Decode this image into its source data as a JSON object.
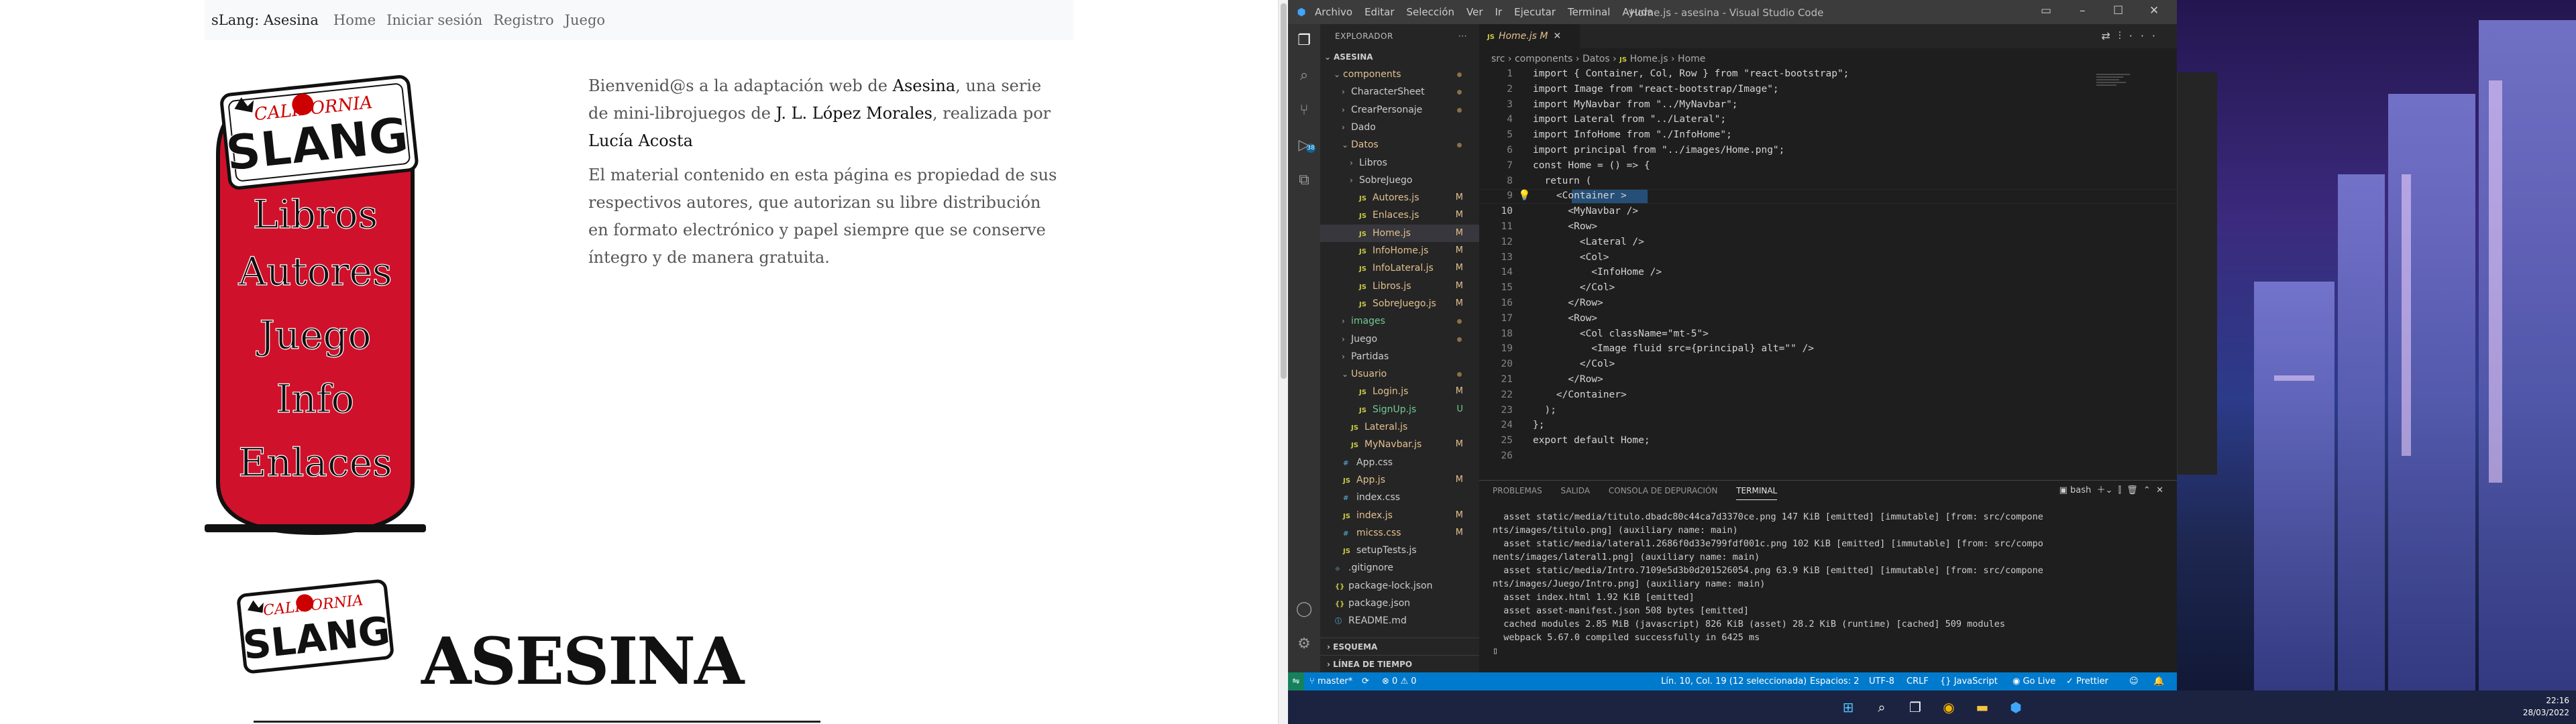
{
  "website": {
    "navbar": {
      "brand": "sLang: Asesina",
      "links": [
        "Home",
        "Iniciar sesión",
        "Registro",
        "Juego"
      ]
    },
    "banner": {
      "logo_top": "CALIFORNIA",
      "logo_main": "SLANG",
      "menu": [
        "Libros",
        "Autores",
        "Juego",
        "Info",
        "Enlaces"
      ]
    },
    "intro": {
      "p1_a": "Bienvenid@s a la adaptación web de ",
      "p1_title": "Asesina",
      "p1_b": ", una serie de mini-librojuegos de ",
      "p1_author": "J. L. López Morales",
      "p1_c": ", realizada por ",
      "p1_maker": "Lucía Acosta",
      "p2": "El material contenido en esta página es propiedad de sus respectivos autores, que autorizan su libre distribución en formato electrónico y papel siempre que se conserve íntegro y de manera gratuita."
    },
    "logo2": {
      "top": "CALIFORNIA",
      "main": "SLANG"
    },
    "game_title": "ASESINA"
  },
  "vscode": {
    "menu": [
      "Archivo",
      "Editar",
      "Selección",
      "Ver",
      "Ir",
      "Ejecutar",
      "Terminal",
      "Ayuda"
    ],
    "window_title": "Home.js - asesina - Visual Studio Code",
    "explorer_title": "EXPLORADOR",
    "project": "ASESINA",
    "tree": [
      {
        "name": "components",
        "type": "folder-open",
        "indent": 1,
        "status": "dot",
        "cls": "m"
      },
      {
        "name": "CharacterSheet",
        "type": "folder",
        "indent": 2,
        "status": "dot",
        "cls": ""
      },
      {
        "name": "CrearPersonaje",
        "type": "folder",
        "indent": 2,
        "status": "dot",
        "cls": ""
      },
      {
        "name": "Dado",
        "type": "folder",
        "indent": 2,
        "status": "",
        "cls": ""
      },
      {
        "name": "Datos",
        "type": "folder-open",
        "indent": 2,
        "status": "dot",
        "cls": "m"
      },
      {
        "name": "Libros",
        "type": "folder",
        "indent": 3,
        "status": "",
        "cls": ""
      },
      {
        "name": "SobreJuego",
        "type": "folder",
        "indent": 3,
        "status": "",
        "cls": ""
      },
      {
        "name": "Autores.js",
        "type": "js",
        "indent": 3,
        "status": "M",
        "cls": "m"
      },
      {
        "name": "Enlaces.js",
        "type": "js",
        "indent": 3,
        "status": "M",
        "cls": "m"
      },
      {
        "name": "Home.js",
        "type": "js",
        "indent": 3,
        "status": "M",
        "cls": "m",
        "selected": true
      },
      {
        "name": "InfoHome.js",
        "type": "js",
        "indent": 3,
        "status": "M",
        "cls": "m"
      },
      {
        "name": "InfoLateral.js",
        "type": "js",
        "indent": 3,
        "status": "M",
        "cls": "m"
      },
      {
        "name": "Libros.js",
        "type": "js",
        "indent": 3,
        "status": "M",
        "cls": "m"
      },
      {
        "name": "SobreJuego.js",
        "type": "js",
        "indent": 3,
        "status": "M",
        "cls": "m"
      },
      {
        "name": "images",
        "type": "folder",
        "indent": 2,
        "status": "dot",
        "cls": "u"
      },
      {
        "name": "Juego",
        "type": "folder",
        "indent": 2,
        "status": "dot",
        "cls": ""
      },
      {
        "name": "Partidas",
        "type": "folder",
        "indent": 2,
        "status": "",
        "cls": ""
      },
      {
        "name": "Usuario",
        "type": "folder-open",
        "indent": 2,
        "status": "dot",
        "cls": "m"
      },
      {
        "name": "Login.js",
        "type": "js",
        "indent": 3,
        "status": "M",
        "cls": "m"
      },
      {
        "name": "SignUp.js",
        "type": "js",
        "indent": 3,
        "status": "U",
        "cls": "u"
      },
      {
        "name": "Lateral.js",
        "type": "js",
        "indent": 2,
        "status": "",
        "cls": "m"
      },
      {
        "name": "MyNavbar.js",
        "type": "js",
        "indent": 2,
        "status": "M",
        "cls": "m"
      },
      {
        "name": "App.css",
        "type": "css",
        "indent": 1,
        "status": "",
        "cls": ""
      },
      {
        "name": "App.js",
        "type": "js",
        "indent": 1,
        "status": "M",
        "cls": "m"
      },
      {
        "name": "index.css",
        "type": "css",
        "indent": 1,
        "status": "",
        "cls": ""
      },
      {
        "name": "index.js",
        "type": "js",
        "indent": 1,
        "status": "M",
        "cls": "m"
      },
      {
        "name": "micss.css",
        "type": "css",
        "indent": 1,
        "status": "M",
        "cls": "m"
      },
      {
        "name": "setupTests.js",
        "type": "js",
        "indent": 1,
        "status": "",
        "cls": ""
      },
      {
        "name": ".gitignore",
        "type": "git",
        "indent": 0,
        "status": "",
        "cls": ""
      },
      {
        "name": "package-lock.json",
        "type": "json",
        "indent": 0,
        "status": "",
        "cls": ""
      },
      {
        "name": "package.json",
        "type": "json",
        "indent": 0,
        "status": "",
        "cls": ""
      },
      {
        "name": "README.md",
        "type": "md",
        "indent": 0,
        "status": "",
        "cls": ""
      }
    ],
    "panels": [
      "ESQUEMA",
      "LÍNEA DE TIEMPO"
    ],
    "tab": {
      "name": "Home.js",
      "flag": "M"
    },
    "breadcrumb": [
      "src",
      "components",
      "Datos",
      "Home.js",
      "Home"
    ],
    "code": [
      [
        "import { Container, Col, Row } from \"react-bootstrap\";"
      ],
      [
        "import Image from \"react-bootstrap/Image\";"
      ],
      [
        "import MyNavbar from \"../MyNavbar\";"
      ],
      [
        "import Lateral from \"../Lateral\";"
      ],
      [
        "import InfoHome from \"./InfoHome\";"
      ],
      [
        "import principal from \"../images/Home.png\";"
      ],
      [
        "const Home = () => {"
      ],
      [
        "  return ("
      ],
      [
        "    <Container >"
      ],
      [
        "      <MyNavbar />"
      ],
      [
        "      <Row>"
      ],
      [
        "        <Lateral />"
      ],
      [
        "        <Col>"
      ],
      [
        "          <InfoHome />"
      ],
      [
        "        </Col>"
      ],
      [
        "      </Row>"
      ],
      [
        "      <Row>"
      ],
      [
        "        <Col className=\"mt-5\">"
      ],
      [
        "          <Image fluid src={principal} alt=\"\" />"
      ],
      [
        "        </Col>"
      ],
      [
        "      </Row>"
      ],
      [
        "    </Container>"
      ],
      [
        "  );"
      ],
      [
        "};"
      ],
      [
        "export default Home;"
      ],
      [
        ""
      ]
    ],
    "panel_tabs": [
      "PROBLEMAS",
      "SALIDA",
      "CONSOLA DE DEPURACIÓN",
      "TERMINAL"
    ],
    "shell": "bash",
    "terminal": [
      "  asset static/media/titulo.dbadc80c44ca7d3370ce.png 147 KiB [emitted] [immutable] [from: src/compone",
      "nts/images/titulo.png] (auxiliary name: main)",
      "  asset static/media/lateral1.2686f0d33e799fdf001c.png 102 KiB [emitted] [immutable] [from: src/compo",
      "nents/images/lateral1.png] (auxiliary name: main)",
      "  asset static/media/Intro.7109e5d3b0d201526054.png 63.9 KiB [emitted] [immutable] [from: src/compone",
      "nts/images/Juego/Intro.png] (auxiliary name: main)",
      "  asset index.html 1.92 KiB [emitted]",
      "  asset asset-manifest.json 508 bytes [emitted]",
      "  cached modules 2.85 MiB (javascript) 826 KiB (asset) 28.2 KiB (runtime) [cached] 509 modules",
      "  webpack 5.67.0 compiled successfully in 6425 ms"
    ],
    "status": {
      "branch": "master*",
      "errors": "0",
      "warnings": "0",
      "position": "Lín. 10, Col. 19 (12 seleccionada)",
      "spaces": "Espacios: 2",
      "encoding": "UTF-8",
      "eol": "CRLF",
      "language": "JavaScript",
      "golive": "Go Live",
      "prettier": "Prettier"
    }
  },
  "taskbar": {
    "time": "22:16",
    "date": "28/03/2022"
  },
  "colors": {
    "banner_red": "#d0112b",
    "vscode_blue": "#007acc",
    "modified": "#e2c08d",
    "untracked": "#73c991"
  }
}
